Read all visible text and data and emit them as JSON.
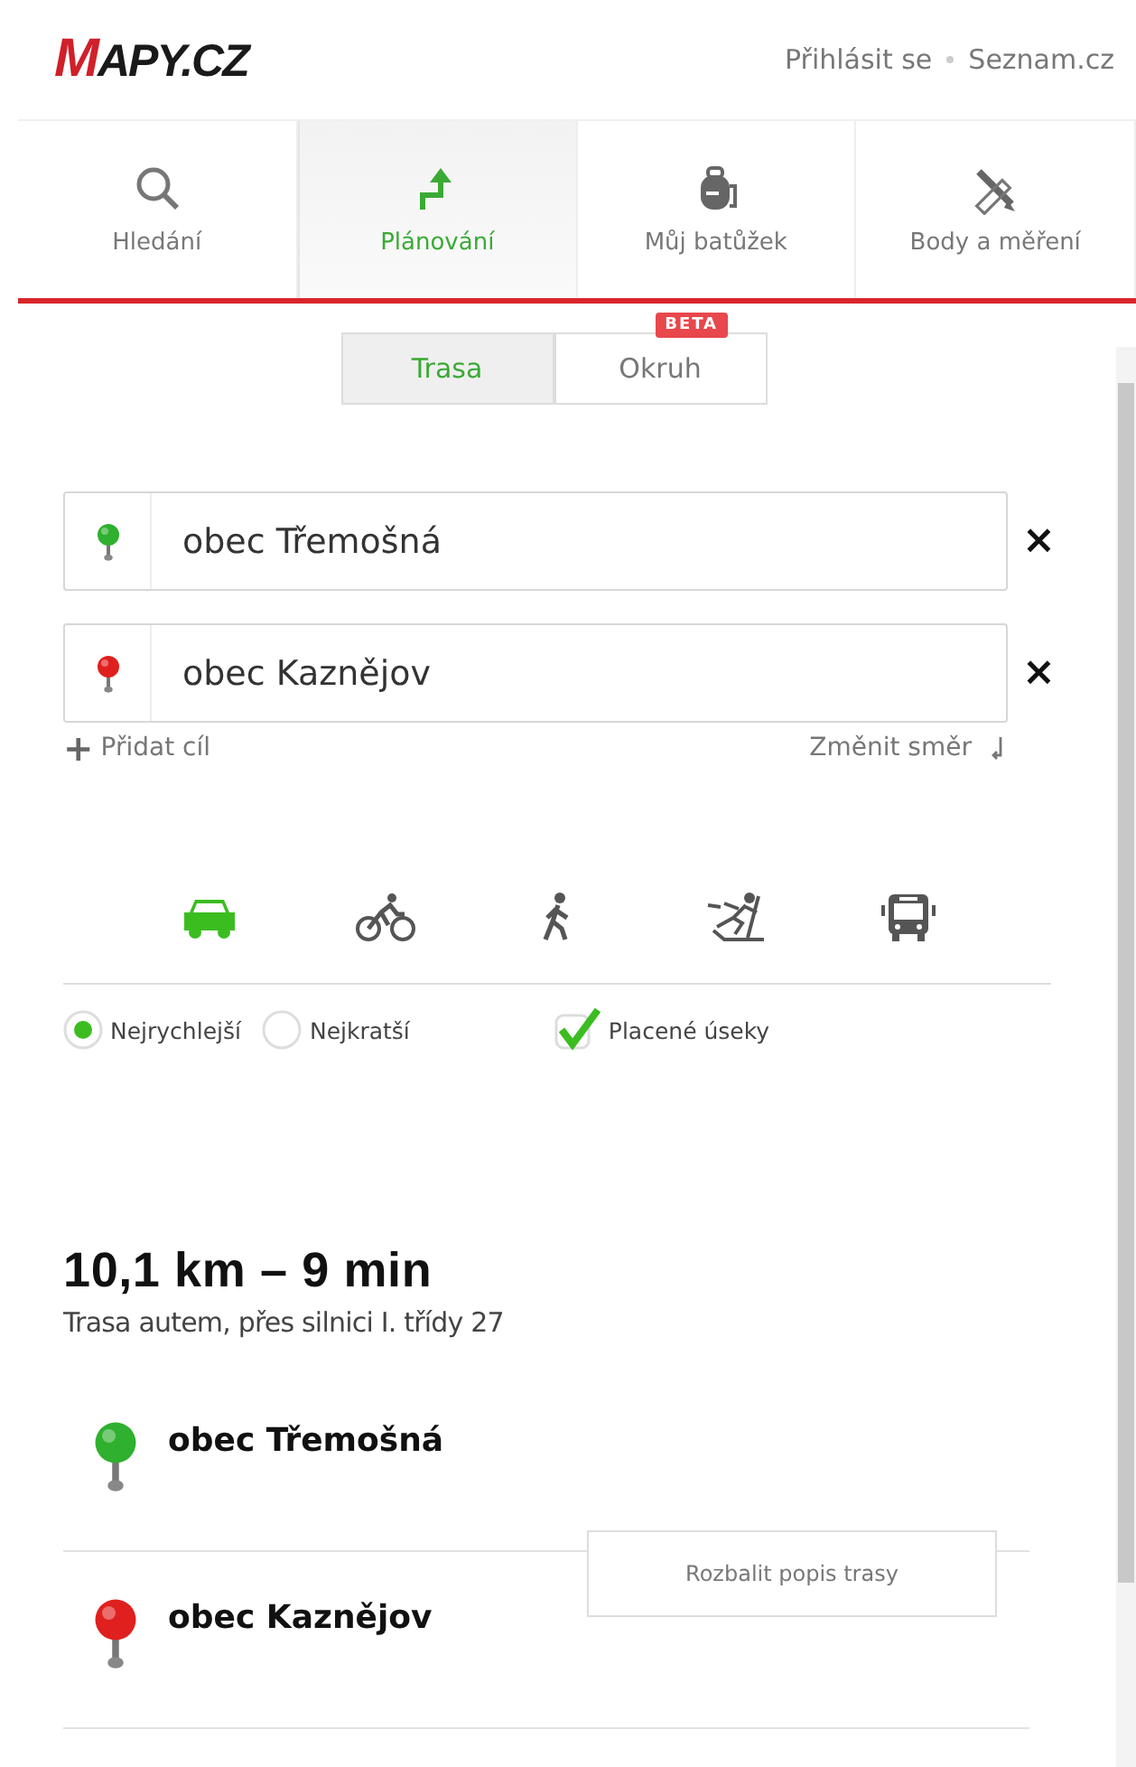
{
  "header": {
    "logo": "MAPY.CZ",
    "links": [
      "Přihlásit se",
      "Seznam.cz"
    ]
  },
  "nav_tabs": [
    {
      "kind": "search",
      "label": "Hledání",
      "selected": false
    },
    {
      "kind": "route",
      "label": "Plánování",
      "selected": true
    },
    {
      "kind": "backpack",
      "label": "Můj batůžek",
      "selected": false
    },
    {
      "kind": "measure",
      "label": "Body a měření",
      "selected": false
    }
  ],
  "sub_tabs": [
    {
      "label": "Trasa",
      "selected": true
    },
    {
      "label": "Okruh",
      "selected": false,
      "badge": "BETA"
    }
  ],
  "waypoints": [
    {
      "value": "obec Třemošná",
      "color": "#2fb02f",
      "remove": "×"
    },
    {
      "value": "obec Kaznějov",
      "color": "#e0201e",
      "remove": "×"
    }
  ],
  "add_destination": {
    "icon": "+",
    "label": "Přidat cíl"
  },
  "reverse": {
    "label": "Změnit směr"
  },
  "modes": [
    {
      "kind": "car",
      "selected": true
    },
    {
      "kind": "bike",
      "selected": false
    },
    {
      "kind": "walk",
      "selected": false
    },
    {
      "kind": "ski",
      "selected": false
    },
    {
      "kind": "bus",
      "selected": false
    }
  ],
  "options": [
    {
      "kind": "radio",
      "label": "Nejrychlejší",
      "selected": true
    },
    {
      "kind": "radio",
      "label": "Nejkratší",
      "selected": false
    },
    {
      "kind": "checkbox",
      "label": "Placené úseky",
      "checked": true
    }
  ],
  "summary": {
    "title": "10,1 km – 9 min",
    "subtitle": "Trasa autem, přes silnici I. třídy 27"
  },
  "stops": [
    {
      "name": "obec Třemošná",
      "color": "#2fb02f"
    },
    {
      "name": "obec Kaznějov",
      "color": "#e0201e"
    }
  ],
  "expand_button": "Rozbalit popis trasy"
}
